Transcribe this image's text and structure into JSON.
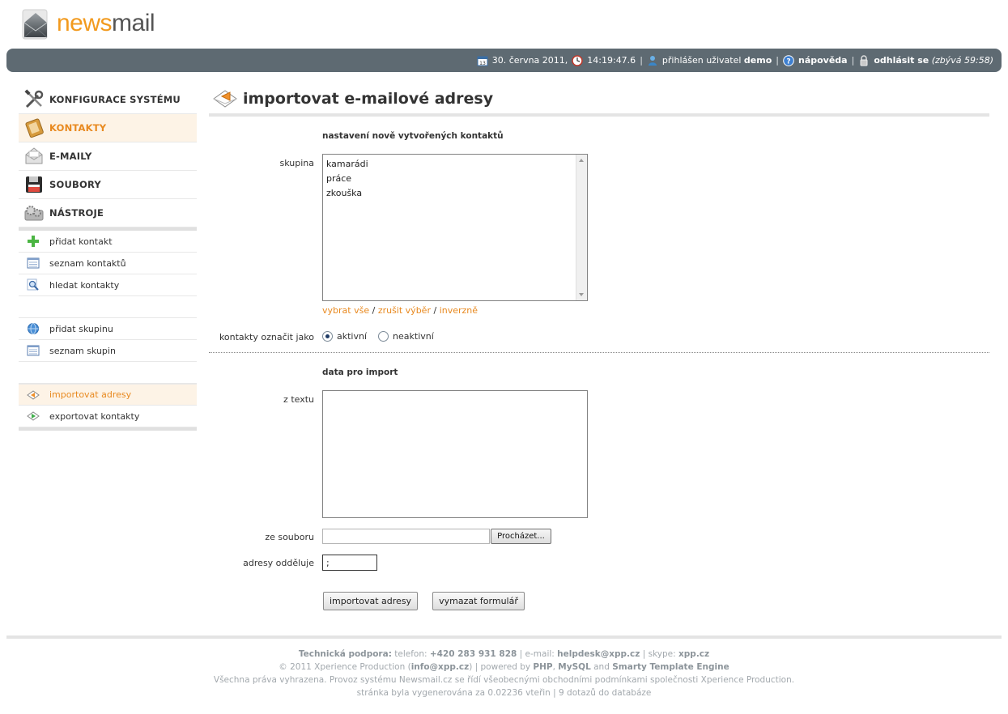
{
  "logo": {
    "news": "news",
    "mail": "mail"
  },
  "topbar": {
    "date": "30. června 2011,",
    "time": "14:19:47.6",
    "sep": "|",
    "user_prefix": "přihlášen uživatel",
    "user_name": "demo",
    "help": "nápověda",
    "logout": "odhlásit se",
    "remaining": "(zbývá 59:58)"
  },
  "sidebar": {
    "main": [
      {
        "label": "KONFIGURACE SYSTÉMU",
        "icon": "tools-icon"
      },
      {
        "label": "KONTAKTY",
        "icon": "address-book-icon",
        "active": true
      },
      {
        "label": "E-MAILY",
        "icon": "envelope-icon"
      },
      {
        "label": "SOUBORY",
        "icon": "floppy-disk-icon"
      },
      {
        "label": "NÁSTROJE",
        "icon": "gears-icon"
      }
    ],
    "sub": [
      {
        "label": "přidat kontakt",
        "icon": "plus-icon"
      },
      {
        "label": "seznam kontaktů",
        "icon": "list-icon"
      },
      {
        "label": "hledat kontakty",
        "icon": "magnifier-icon"
      },
      {
        "label": "přidat skupinu",
        "icon": "globe-icon"
      },
      {
        "label": "seznam skupin",
        "icon": "list-icon"
      },
      {
        "label": "importovat adresy",
        "icon": "import-icon",
        "active": true
      },
      {
        "label": "exportovat kontakty",
        "icon": "export-icon"
      }
    ]
  },
  "main": {
    "title": "importovat e-mailové adresy",
    "section1_title": "nastavení nově vytvořených kontaktů",
    "group_label": "skupina",
    "groups": [
      "kamarádi",
      "práce",
      "zkouška"
    ],
    "select_all": "vybrat vše",
    "deselect": "zrušit výběr",
    "invert": "inverzně",
    "slash": "/",
    "mark_label": "kontakty označit jako",
    "active_label": "aktivní",
    "inactive_label": "neaktivní",
    "section2_title": "data pro import",
    "text_label": "z textu",
    "file_label": "ze souboru",
    "browse": "Procházet...",
    "separator_label": "adresy odděluje",
    "separator_value": ";",
    "import_button": "importovat adresy",
    "clear_button": "vymazat formulář"
  },
  "footer": {
    "support_label": "Technická podpora:",
    "phone_label": "telefon:",
    "phone": "+420 283 931 828",
    "email_label": "e-mail:",
    "email": "helpdesk@xpp.cz",
    "skype_label": "skype:",
    "skype": "xpp.cz",
    "copyright": "© 2011 Xperience Production (",
    "copyright_email": "info@xpp.cz",
    "powered": ") | powered by",
    "php": "PHP",
    "mysql": "MySQL",
    "and": "and",
    "smarty": "Smarty Template Engine",
    "rights": "Všechna práva vyhrazena. Provoz systému Newsmail.cz se řídí všeobecnými obchodními podmínkami společnosti Xperience Production.",
    "generated": "stránka byla vygenerována za 0.02236 vteřin | 9 dotazů do databáze"
  }
}
